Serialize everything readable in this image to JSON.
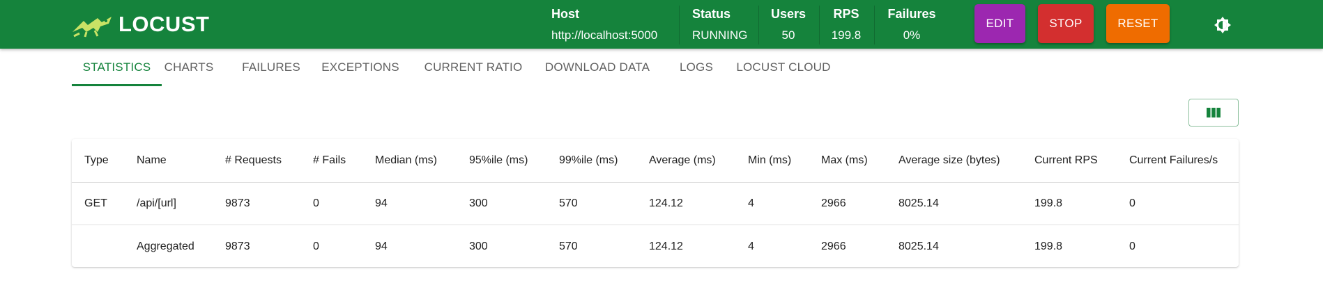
{
  "app": {
    "name": "LOCUST"
  },
  "header": {
    "stats": [
      {
        "label": "Host",
        "value": "http://localhost:5000"
      },
      {
        "label": "Status",
        "value": "RUNNING"
      },
      {
        "label": "Users",
        "value": "50"
      },
      {
        "label": "RPS",
        "value": "199.8"
      },
      {
        "label": "Failures",
        "value": "0%"
      }
    ],
    "buttons": {
      "edit": "EDIT",
      "stop": "STOP",
      "reset": "RESET"
    },
    "icons": {
      "theme": "brightness-toggle-icon",
      "logo": "locust-grasshopper-icon",
      "columns": "view-columns-icon"
    }
  },
  "tabs": [
    {
      "label": "STATISTICS",
      "active": true
    },
    {
      "label": "CHARTS"
    },
    {
      "label": "FAILURES"
    },
    {
      "label": "EXCEPTIONS"
    },
    {
      "label": "CURRENT RATIO"
    },
    {
      "label": "DOWNLOAD DATA"
    },
    {
      "label": "LOGS"
    },
    {
      "label": "LOCUST CLOUD"
    }
  ],
  "table": {
    "columns": [
      "Type",
      "Name",
      "# Requests",
      "# Fails",
      "Median (ms)",
      "95%ile (ms)",
      "99%ile (ms)",
      "Average (ms)",
      "Min (ms)",
      "Max (ms)",
      "Average size (bytes)",
      "Current RPS",
      "Current Failures/s"
    ],
    "rows": [
      [
        "GET",
        "/api/[url]",
        "9873",
        "0",
        "94",
        "300",
        "570",
        "124.12",
        "4",
        "2966",
        "8025.14",
        "199.8",
        "0"
      ],
      [
        "",
        "Aggregated",
        "9873",
        "0",
        "94",
        "300",
        "570",
        "124.12",
        "4",
        "2966",
        "8025.14",
        "199.8",
        "0"
      ]
    ]
  },
  "colors": {
    "brand_green": "#15833c",
    "edit": "#9c27b0",
    "stop": "#d32f2f",
    "reset": "#ef6c00"
  }
}
